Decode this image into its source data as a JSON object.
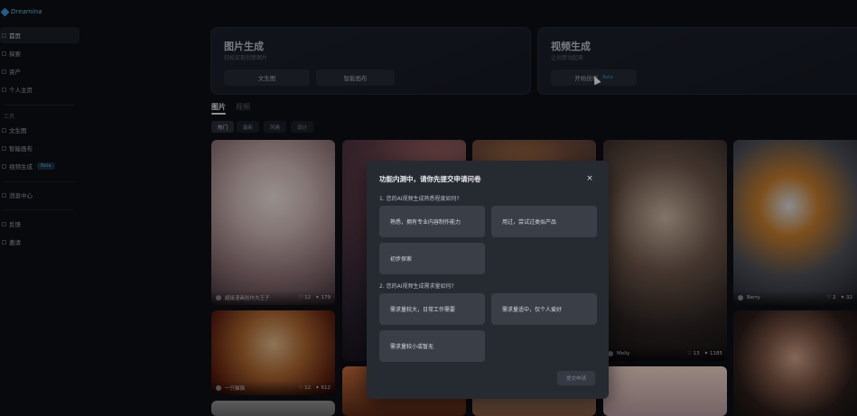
{
  "app": {
    "logo_text": "Dreamina"
  },
  "sidebar": {
    "items": [
      {
        "label": "首页",
        "active": true
      },
      {
        "label": "探索"
      },
      {
        "label": "资产"
      },
      {
        "label": "个人主页"
      }
    ],
    "tools_label": "工具",
    "tools": [
      {
        "label": "文生图"
      },
      {
        "label": "智能画布"
      },
      {
        "label": "视频生成",
        "badge": "Beta"
      }
    ],
    "bottom_items": [
      {
        "label": "消息中心"
      },
      {
        "label": "反馈"
      },
      {
        "label": "邀请"
      }
    ]
  },
  "cards": {
    "image": {
      "title": "图片生成",
      "subtitle": "轻松实现创意图片",
      "buttons": [
        "文生图",
        "智能画布"
      ]
    },
    "video": {
      "title": "视频生成",
      "subtitle": "让创意动起来",
      "button": "开始创作",
      "badge": "Beta"
    }
  },
  "tabs": [
    "图片",
    "视频"
  ],
  "filters": [
    "热门",
    "最新",
    "风格",
    "设计"
  ],
  "gallery": [
    {
      "author": "超级漫画创作大王子",
      "likes": "12",
      "uses": "179"
    },
    {
      "author": "一只猫猫",
      "likes": "12",
      "uses": "612"
    },
    {
      "author": "Molly",
      "likes": "13",
      "uses": "1185"
    },
    {
      "author": "Berry",
      "likes": "2",
      "uses": "32"
    }
  ],
  "modal": {
    "title": "功能内测中，请你先提交申请问卷",
    "close_icon": "×",
    "q1": {
      "label": "1. 您的AI视频生成熟悉程度如何?",
      "options": [
        "熟悉，拥有专业内容制作能力",
        "用过，尝试过类似产品",
        "初步探索"
      ]
    },
    "q2": {
      "label": "2. 您的AI视频生成需求量如何?",
      "options": [
        "需求量较大，日常工作需要",
        "需求量适中，仅个人爱好",
        "需求量较小或暂无"
      ]
    },
    "submit_label": "提交申请"
  },
  "colors": {
    "background": "#0c0f14",
    "modal": "#262a31",
    "option": "#393e47",
    "accent": "#3a8fc0"
  }
}
